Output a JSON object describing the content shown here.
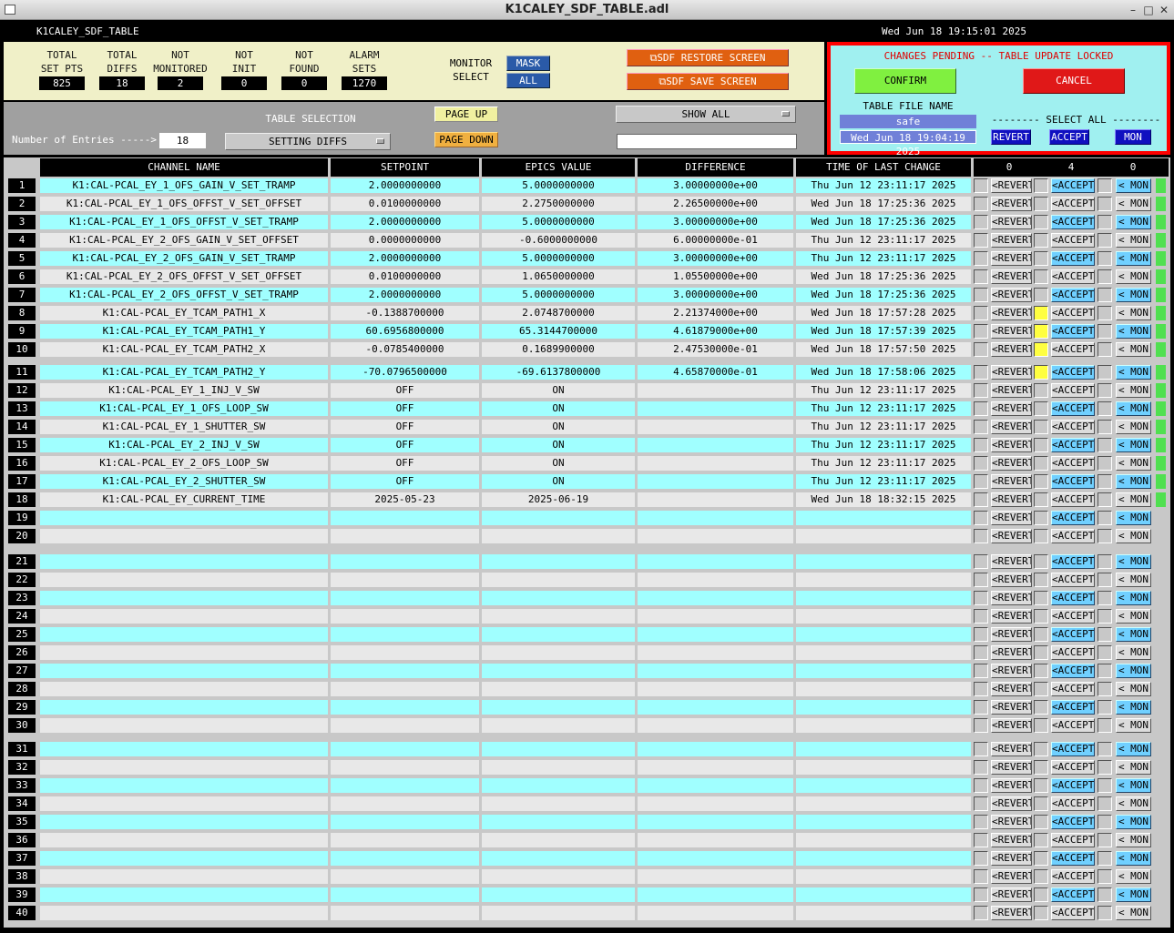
{
  "window": {
    "title": "K1CALEY_SDF_TABLE.adl"
  },
  "header": {
    "screen_name": "K1CALEY_SDF_TABLE",
    "datetime": "Wed Jun 18 19:15:01 2025"
  },
  "counters": [
    {
      "label1": "TOTAL",
      "label2": "SET PTS",
      "value": "825"
    },
    {
      "label1": "TOTAL",
      "label2": "DIFFS",
      "value": "18"
    },
    {
      "label1": "NOT",
      "label2": "MONITORED",
      "value": "2"
    },
    {
      "label1": "NOT",
      "label2": "INIT",
      "value": "0"
    },
    {
      "label1": "NOT",
      "label2": "FOUND",
      "value": "0"
    },
    {
      "label1": "ALARM",
      "label2": "SETS",
      "value": "1270"
    }
  ],
  "monitor": {
    "label1": "MONITOR",
    "label2": "SELECT",
    "mask": "MASK",
    "all": "ALL"
  },
  "sdf": {
    "restore": "SDF RESTORE SCREEN",
    "save": "SDF SAVE SCREEN"
  },
  "pending": {
    "message": "CHANGES PENDING -- TABLE UPDATE LOCKED",
    "confirm": "CONFIRM",
    "cancel": "CANCEL",
    "table_file_label": "TABLE FILE NAME",
    "table_file": "safe",
    "file_time": "Wed Jun 18 19:04:19 2025",
    "select_all": "-------- SELECT ALL --------",
    "revert": "REVERT",
    "accept": "ACCEPT",
    "mon": "MON"
  },
  "controls": {
    "entries_label": "Number of Entries ----->",
    "entries": "18",
    "table_selection_label": "TABLE SELECTION",
    "table_selection": "SETTING DIFFS",
    "page_up": "PAGE UP",
    "page_down": "PAGE DOWN",
    "show_all": "SHOW ALL",
    "search_value": ""
  },
  "columns": {
    "channel": "CHANNEL NAME",
    "setpoint": "SETPOINT",
    "epics": "EPICS VALUE",
    "difference": "DIFFERENCE",
    "time": "TIME OF LAST CHANGE",
    "count_revert": "0",
    "count_accept": "4",
    "count_mon": "0"
  },
  "row_buttons": {
    "revert": "<REVERT",
    "accept": "<ACCEPT",
    "mon": "< MON"
  },
  "colors": {
    "cyan": "#a0ffff",
    "gray_row": "#e8e8e8",
    "alarm_red": "#ff0000",
    "confirm_green": "#80f040",
    "cancel_red": "#e01818",
    "accept_yellow": "#ffff40",
    "status_green": "#50e050"
  },
  "rows": [
    {
      "channel": "K1:CAL-PCAL_EY_1_OFS_GAIN_V_SET_TRAMP",
      "setpoint": "2.0000000000",
      "epics": "5.0000000000",
      "difference": "3.00000000e+00",
      "time": "Thu Jun 12 23:11:17 2025",
      "accept_flag": false,
      "status": true
    },
    {
      "channel": "K1:CAL-PCAL_EY_1_OFS_OFFST_V_SET_OFFSET",
      "setpoint": "0.0100000000",
      "epics": "2.2750000000",
      "difference": "2.26500000e+00",
      "time": "Wed Jun 18 17:25:36 2025",
      "accept_flag": false,
      "status": true
    },
    {
      "channel": "K1:CAL-PCAL_EY_1_OFS_OFFST_V_SET_TRAMP",
      "setpoint": "2.0000000000",
      "epics": "5.0000000000",
      "difference": "3.00000000e+00",
      "time": "Wed Jun 18 17:25:36 2025",
      "accept_flag": false,
      "status": true
    },
    {
      "channel": "K1:CAL-PCAL_EY_2_OFS_GAIN_V_SET_OFFSET",
      "setpoint": "0.0000000000",
      "epics": "-0.6000000000",
      "difference": "6.00000000e-01",
      "time": "Thu Jun 12 23:11:17 2025",
      "accept_flag": false,
      "status": true
    },
    {
      "channel": "K1:CAL-PCAL_EY_2_OFS_GAIN_V_SET_TRAMP",
      "setpoint": "2.0000000000",
      "epics": "5.0000000000",
      "difference": "3.00000000e+00",
      "time": "Thu Jun 12 23:11:17 2025",
      "accept_flag": false,
      "status": true
    },
    {
      "channel": "K1:CAL-PCAL_EY_2_OFS_OFFST_V_SET_OFFSET",
      "setpoint": "0.0100000000",
      "epics": "1.0650000000",
      "difference": "1.05500000e+00",
      "time": "Wed Jun 18 17:25:36 2025",
      "accept_flag": false,
      "status": true
    },
    {
      "channel": "K1:CAL-PCAL_EY_2_OFS_OFFST_V_SET_TRAMP",
      "setpoint": "2.0000000000",
      "epics": "5.0000000000",
      "difference": "3.00000000e+00",
      "time": "Wed Jun 18 17:25:36 2025",
      "accept_flag": false,
      "status": true
    },
    {
      "channel": "K1:CAL-PCAL_EY_TCAM_PATH1_X",
      "setpoint": "-0.1388700000",
      "epics": "2.0748700000",
      "difference": "2.21374000e+00",
      "time": "Wed Jun 18 17:57:28 2025",
      "accept_flag": true,
      "status": true
    },
    {
      "channel": "K1:CAL-PCAL_EY_TCAM_PATH1_Y",
      "setpoint": "60.6956800000",
      "epics": "65.3144700000",
      "difference": "4.61879000e+00",
      "time": "Wed Jun 18 17:57:39 2025",
      "accept_flag": true,
      "status": true
    },
    {
      "channel": "K1:CAL-PCAL_EY_TCAM_PATH2_X",
      "setpoint": "-0.0785400000",
      "epics": "0.1689900000",
      "difference": "2.47530000e-01",
      "time": "Wed Jun 18 17:57:50 2025",
      "accept_flag": true,
      "status": true
    },
    {
      "channel": "K1:CAL-PCAL_EY_TCAM_PATH2_Y",
      "setpoint": "-70.0796500000",
      "epics": "-69.6137800000",
      "difference": "4.65870000e-01",
      "time": "Wed Jun 18 17:58:06 2025",
      "accept_flag": true,
      "status": true
    },
    {
      "channel": "K1:CAL-PCAL_EY_1_INJ_V_SW",
      "setpoint": "OFF",
      "epics": "ON",
      "difference": "",
      "time": "Thu Jun 12 23:11:17 2025",
      "accept_flag": false,
      "status": true
    },
    {
      "channel": "K1:CAL-PCAL_EY_1_OFS_LOOP_SW",
      "setpoint": "OFF",
      "epics": "ON",
      "difference": "",
      "time": "Thu Jun 12 23:11:17 2025",
      "accept_flag": false,
      "status": true
    },
    {
      "channel": "K1:CAL-PCAL_EY_1_SHUTTER_SW",
      "setpoint": "OFF",
      "epics": "ON",
      "difference": "",
      "time": "Thu Jun 12 23:11:17 2025",
      "accept_flag": false,
      "status": true
    },
    {
      "channel": "K1:CAL-PCAL_EY_2_INJ_V_SW",
      "setpoint": "OFF",
      "epics": "ON",
      "difference": "",
      "time": "Thu Jun 12 23:11:17 2025",
      "accept_flag": false,
      "status": true
    },
    {
      "channel": "K1:CAL-PCAL_EY_2_OFS_LOOP_SW",
      "setpoint": "OFF",
      "epics": "ON",
      "difference": "",
      "time": "Thu Jun 12 23:11:17 2025",
      "accept_flag": false,
      "status": true
    },
    {
      "channel": "K1:CAL-PCAL_EY_2_SHUTTER_SW",
      "setpoint": "OFF",
      "epics": "ON",
      "difference": "",
      "time": "Thu Jun 12 23:11:17 2025",
      "accept_flag": false,
      "status": true
    },
    {
      "channel": "K1:CAL-PCAL_EY_CURRENT_TIME",
      "setpoint": "2025-05-23",
      "epics": "2025-06-19",
      "difference": "",
      "time": "Wed Jun 18 18:32:15 2025",
      "accept_flag": false,
      "status": true
    },
    {
      "channel": "",
      "setpoint": "",
      "epics": "",
      "difference": "",
      "time": "",
      "accept_flag": false,
      "status": false
    },
    {
      "channel": "",
      "setpoint": "",
      "epics": "",
      "difference": "",
      "time": "",
      "accept_flag": false,
      "status": false
    },
    {
      "channel": "",
      "setpoint": "",
      "epics": "",
      "difference": "",
      "time": "",
      "accept_flag": false,
      "status": false
    },
    {
      "channel": "",
      "setpoint": "",
      "epics": "",
      "difference": "",
      "time": "",
      "accept_flag": false,
      "status": false
    },
    {
      "channel": "",
      "setpoint": "",
      "epics": "",
      "difference": "",
      "time": "",
      "accept_flag": false,
      "status": false
    },
    {
      "channel": "",
      "setpoint": "",
      "epics": "",
      "difference": "",
      "time": "",
      "accept_flag": false,
      "status": false
    },
    {
      "channel": "",
      "setpoint": "",
      "epics": "",
      "difference": "",
      "time": "",
      "accept_flag": false,
      "status": false
    },
    {
      "channel": "",
      "setpoint": "",
      "epics": "",
      "difference": "",
      "time": "",
      "accept_flag": false,
      "status": false
    },
    {
      "channel": "",
      "setpoint": "",
      "epics": "",
      "difference": "",
      "time": "",
      "accept_flag": false,
      "status": false
    },
    {
      "channel": "",
      "setpoint": "",
      "epics": "",
      "difference": "",
      "time": "",
      "accept_flag": false,
      "status": false
    },
    {
      "channel": "",
      "setpoint": "",
      "epics": "",
      "difference": "",
      "time": "",
      "accept_flag": false,
      "status": false
    },
    {
      "channel": "",
      "setpoint": "",
      "epics": "",
      "difference": "",
      "time": "",
      "accept_flag": false,
      "status": false
    },
    {
      "channel": "",
      "setpoint": "",
      "epics": "",
      "difference": "",
      "time": "",
      "accept_flag": false,
      "status": false
    },
    {
      "channel": "",
      "setpoint": "",
      "epics": "",
      "difference": "",
      "time": "",
      "accept_flag": false,
      "status": false
    },
    {
      "channel": "",
      "setpoint": "",
      "epics": "",
      "difference": "",
      "time": "",
      "accept_flag": false,
      "status": false
    },
    {
      "channel": "",
      "setpoint": "",
      "epics": "",
      "difference": "",
      "time": "",
      "accept_flag": false,
      "status": false
    },
    {
      "channel": "",
      "setpoint": "",
      "epics": "",
      "difference": "",
      "time": "",
      "accept_flag": false,
      "status": false
    },
    {
      "channel": "",
      "setpoint": "",
      "epics": "",
      "difference": "",
      "time": "",
      "accept_flag": false,
      "status": false
    },
    {
      "channel": "",
      "setpoint": "",
      "epics": "",
      "difference": "",
      "time": "",
      "accept_flag": false,
      "status": false
    },
    {
      "channel": "",
      "setpoint": "",
      "epics": "",
      "difference": "",
      "time": "",
      "accept_flag": false,
      "status": false
    },
    {
      "channel": "",
      "setpoint": "",
      "epics": "",
      "difference": "",
      "time": "",
      "accept_flag": false,
      "status": false
    },
    {
      "channel": "",
      "setpoint": "",
      "epics": "",
      "difference": "",
      "time": "",
      "accept_flag": false,
      "status": false
    }
  ]
}
